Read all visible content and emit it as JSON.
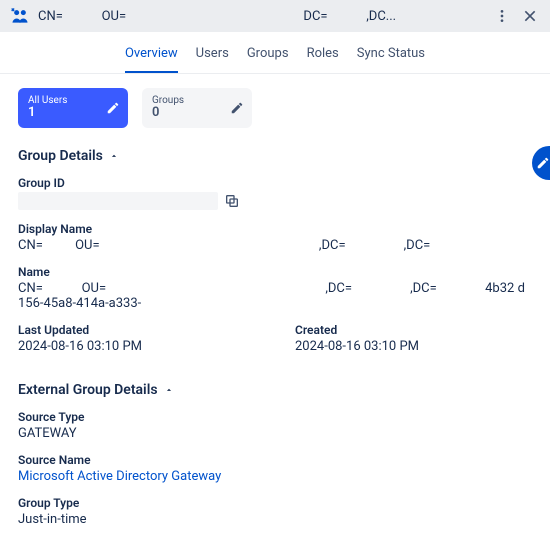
{
  "header": {
    "title": "CN=            OU=                                                       DC=            ,DC..."
  },
  "tabs": [
    {
      "label": "Overview",
      "active": true
    },
    {
      "label": "Users"
    },
    {
      "label": "Groups"
    },
    {
      "label": "Roles"
    },
    {
      "label": "Sync Status"
    }
  ],
  "cards": {
    "allUsers": {
      "label": "All Users",
      "value": "1"
    },
    "groups": {
      "label": "Groups",
      "value": "0"
    }
  },
  "groupDetails": {
    "title": "Group Details",
    "fields": {
      "groupId_label": "Group ID",
      "displayName_label": "Display Name",
      "displayName_value": "CN=           OU=                                                                    ,DC=                  ,DC=",
      "name_label": "Name",
      "name_value": "CN=            OU=                                                                    ,DC=                  ,DC=               4b32 d156-45a8-414a-a333-",
      "lastUpdated_label": "Last Updated",
      "lastUpdated_value": "2024-08-16 03:10 PM",
      "created_label": "Created",
      "created_value": "2024-08-16 03:10 PM"
    }
  },
  "externalGroupDetails": {
    "title": "External Group Details",
    "fields": {
      "sourceType_label": "Source Type",
      "sourceType_value": "GATEWAY",
      "sourceName_label": "Source Name",
      "sourceName_value": "Microsoft Active Directory Gateway",
      "groupType_label": "Group Type",
      "groupType_value": "Just-in-time"
    }
  }
}
